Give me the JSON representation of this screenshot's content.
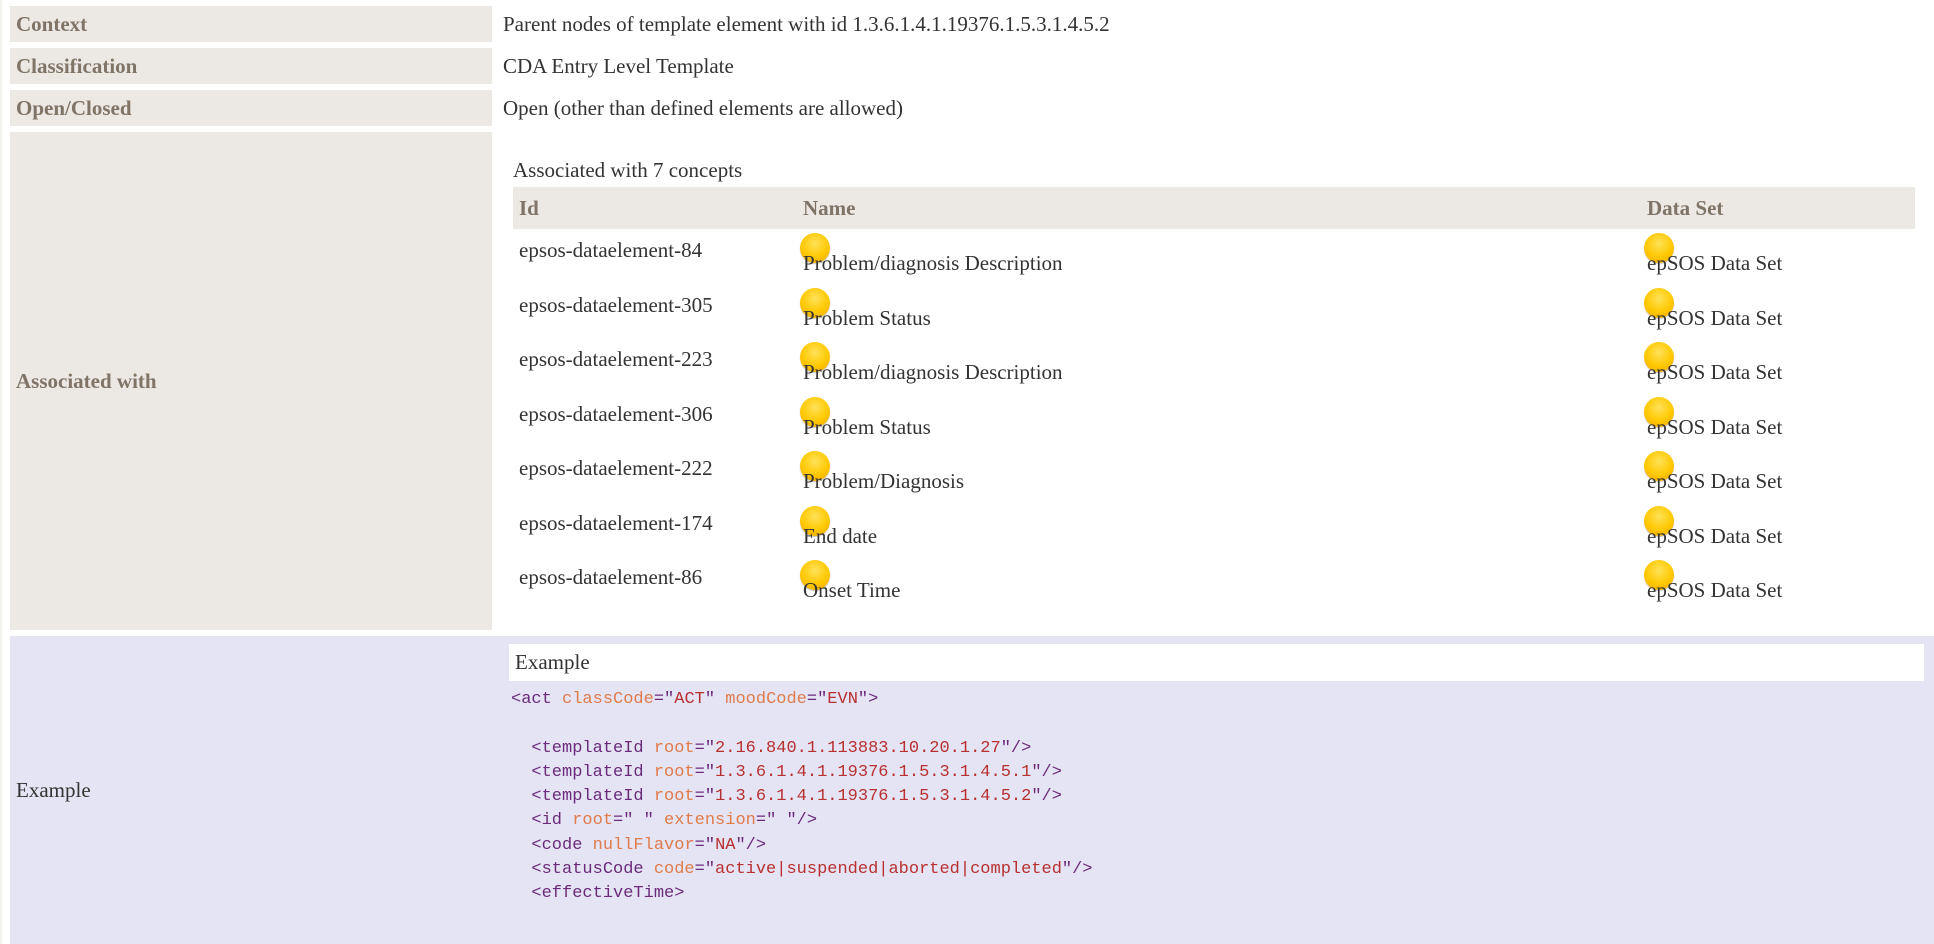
{
  "rows": {
    "context": {
      "label": "Context",
      "value": "Parent nodes of template element with id 1.3.6.1.4.1.19376.1.5.3.1.4.5.2"
    },
    "classification": {
      "label": "Classification",
      "value": "CDA Entry Level Template"
    },
    "open_closed": {
      "label": "Open/Closed",
      "value": "Open (other than defined elements are allowed)"
    },
    "associated": {
      "label": "Associated with",
      "caption": "Associated with 7 concepts",
      "columns": [
        "Id",
        "Name",
        "Data Set"
      ],
      "concepts": [
        {
          "id": "epsos-dataelement-84",
          "name": "Problem/diagnosis Description",
          "dataset": "epSOS Data Set"
        },
        {
          "id": "epsos-dataelement-305",
          "name": "Problem Status",
          "dataset": "epSOS Data Set"
        },
        {
          "id": "epsos-dataelement-223",
          "name": "Problem/diagnosis Description",
          "dataset": "epSOS Data Set"
        },
        {
          "id": "epsos-dataelement-306",
          "name": "Problem Status",
          "dataset": "epSOS Data Set"
        },
        {
          "id": "epsos-dataelement-222",
          "name": "Problem/Diagnosis",
          "dataset": "epSOS Data Set"
        },
        {
          "id": "epsos-dataelement-174",
          "name": "End date",
          "dataset": "epSOS Data Set"
        },
        {
          "id": "epsos-dataelement-86",
          "name": "Onset Time",
          "dataset": "epSOS Data Set"
        }
      ]
    },
    "example": {
      "label": "Example",
      "header": "Example",
      "code_lines": [
        [
          {
            "k": "t",
            "s": "<act "
          },
          {
            "k": "a",
            "s": "classCode"
          },
          {
            "k": "t",
            "s": "=\""
          },
          {
            "k": "v",
            "s": "ACT"
          },
          {
            "k": "t",
            "s": "\" "
          },
          {
            "k": "a",
            "s": "moodCode"
          },
          {
            "k": "t",
            "s": "=\""
          },
          {
            "k": "v",
            "s": "EVN"
          },
          {
            "k": "t",
            "s": "\">"
          }
        ],
        [],
        [
          {
            "k": "t",
            "s": "  <templateId "
          },
          {
            "k": "a",
            "s": "root"
          },
          {
            "k": "t",
            "s": "=\""
          },
          {
            "k": "v",
            "s": "2.16.840.1.113883.10.20.1.27"
          },
          {
            "k": "t",
            "s": "\"/>"
          }
        ],
        [
          {
            "k": "t",
            "s": "  <templateId "
          },
          {
            "k": "a",
            "s": "root"
          },
          {
            "k": "t",
            "s": "=\""
          },
          {
            "k": "v",
            "s": "1.3.6.1.4.1.19376.1.5.3.1.4.5.1"
          },
          {
            "k": "t",
            "s": "\"/>"
          }
        ],
        [
          {
            "k": "t",
            "s": "  <templateId "
          },
          {
            "k": "a",
            "s": "root"
          },
          {
            "k": "t",
            "s": "=\""
          },
          {
            "k": "v",
            "s": "1.3.6.1.4.1.19376.1.5.3.1.4.5.2"
          },
          {
            "k": "t",
            "s": "\"/>"
          }
        ],
        [
          {
            "k": "t",
            "s": "  <id "
          },
          {
            "k": "a",
            "s": "root"
          },
          {
            "k": "t",
            "s": "=\""
          },
          {
            "k": "v",
            "s": " "
          },
          {
            "k": "t",
            "s": "\" "
          },
          {
            "k": "a",
            "s": "extension"
          },
          {
            "k": "t",
            "s": "=\""
          },
          {
            "k": "v",
            "s": " "
          },
          {
            "k": "t",
            "s": "\"/>"
          }
        ],
        [
          {
            "k": "t",
            "s": "  <code "
          },
          {
            "k": "a",
            "s": "nullFlavor"
          },
          {
            "k": "t",
            "s": "=\""
          },
          {
            "k": "v",
            "s": "NA"
          },
          {
            "k": "t",
            "s": "\"/>"
          }
        ],
        [
          {
            "k": "t",
            "s": "  <statusCode "
          },
          {
            "k": "a",
            "s": "code"
          },
          {
            "k": "t",
            "s": "=\""
          },
          {
            "k": "v",
            "s": "active|suspended|aborted|completed"
          },
          {
            "k": "t",
            "s": "\"/>"
          }
        ],
        [
          {
            "k": "t",
            "s": "  <effectiveTime>"
          }
        ]
      ]
    }
  },
  "icons": {
    "concept_dot": "yellow-ball-icon",
    "dataset_dot": "yellow-ball-icon"
  },
  "colors": {
    "label_bg": "#ece9e4",
    "label_text": "#7f7465",
    "example_bg": "#e4e4f5",
    "tag": "#6b2b7a",
    "attr": "#e07b4a",
    "value": "#b83030"
  }
}
